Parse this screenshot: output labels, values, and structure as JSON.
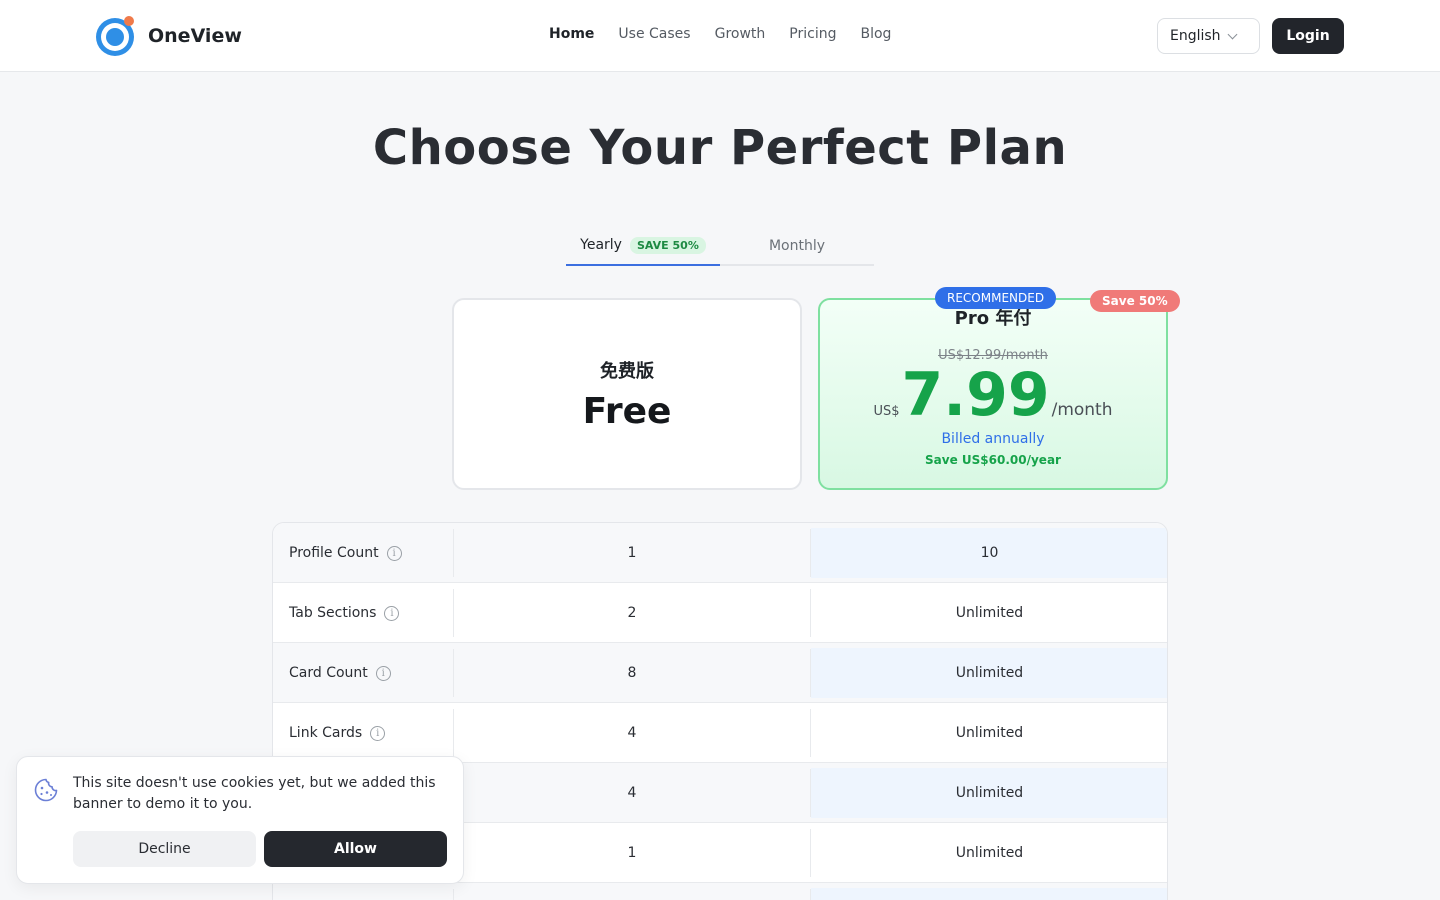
{
  "header": {
    "brand": "OneView",
    "nav": [
      {
        "label": "Home",
        "active": true
      },
      {
        "label": "Use Cases",
        "active": false
      },
      {
        "label": "Growth",
        "active": false
      },
      {
        "label": "Pricing",
        "active": false
      },
      {
        "label": "Blog",
        "active": false
      }
    ],
    "language": "English",
    "login_label": "Login"
  },
  "hero": {
    "title": "Choose Your Perfect Plan"
  },
  "billing_tabs": {
    "yearly_label": "Yearly",
    "yearly_badge": "SAVE 50%",
    "monthly_label": "Monthly",
    "selected": "Yearly"
  },
  "plans": {
    "free": {
      "name": "免费版",
      "price": "Free"
    },
    "pro": {
      "badge": "RECOMMENDED",
      "corner_badge": "Save 50%",
      "name": "Pro 年付",
      "old_price": "US$12.99/month",
      "currency": "US$",
      "amount": "7.99",
      "period": "/month",
      "billed": "Billed annually",
      "savings": "Save US$60.00/year"
    }
  },
  "features": {
    "rows": [
      {
        "label": "Profile Count",
        "free": "1",
        "pro": "10"
      },
      {
        "label": "Tab Sections",
        "free": "2",
        "pro": "Unlimited"
      },
      {
        "label": "Card Count",
        "free": "8",
        "pro": "Unlimited"
      },
      {
        "label": "Link Cards",
        "free": "4",
        "pro": "Unlimited"
      },
      {
        "label": "",
        "free": "4",
        "pro": "Unlimited"
      },
      {
        "label": "",
        "free": "1",
        "pro": "Unlimited"
      },
      {
        "label": "",
        "free": "",
        "pro": ""
      }
    ]
  },
  "cookie_banner": {
    "message": "This site doesn't use cookies yet, but we added this banner to demo it to you.",
    "decline_label": "Decline",
    "allow_label": "Allow"
  },
  "icons": {
    "info": "info-icon",
    "cookie": "cookie-icon",
    "chevron": "chevron-down-icon"
  },
  "colors": {
    "accent_blue": "#2f6fe8",
    "accent_green": "#16a34a",
    "dark_button": "#22252b",
    "save_red": "#f07a78"
  }
}
